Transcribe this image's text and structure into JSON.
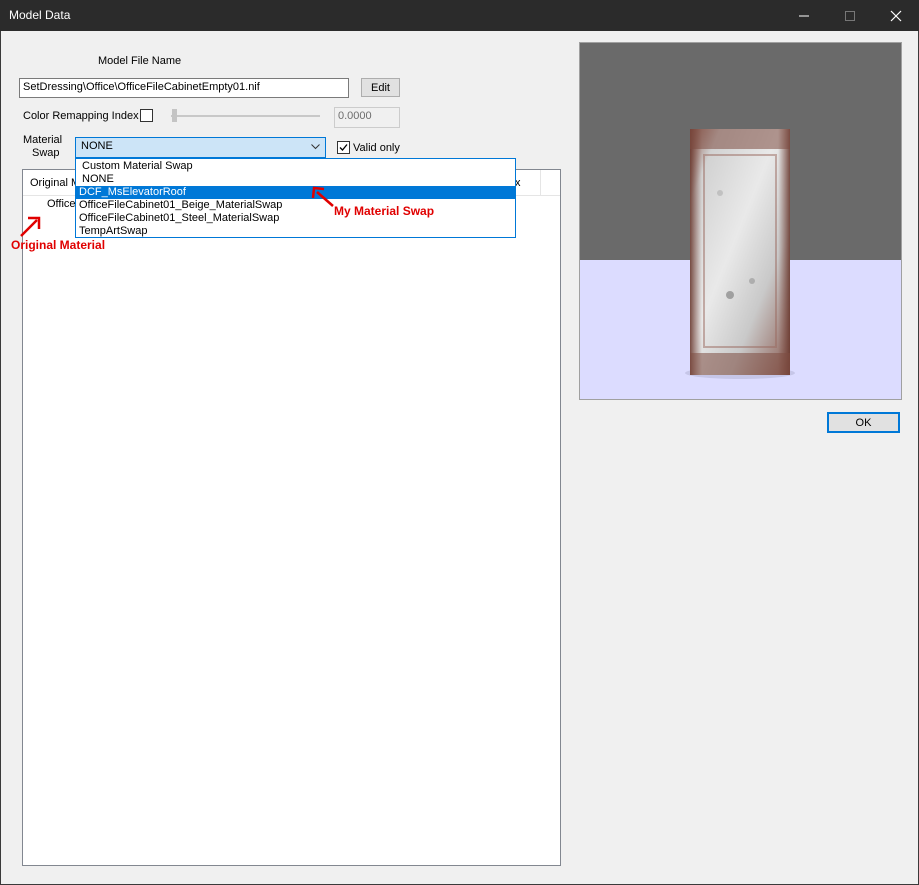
{
  "window": {
    "title": "Model Data",
    "minimize_icon": "minimize-icon",
    "maximize_icon": "maximize-icon",
    "close_icon": "close-icon"
  },
  "model_file": {
    "label": "Model File Name",
    "value": "SetDressing\\Office\\OfficeFileCabinetEmpty01.nif",
    "edit_label": "Edit"
  },
  "color_remap": {
    "label": "Color Remapping Index",
    "checked": false,
    "value": "0.0000",
    "slider_level": 0
  },
  "material_swap": {
    "label_line1": "Material",
    "label_line2": "Swap",
    "selected": "NONE",
    "valid_only_label": "Valid only",
    "valid_only_checked": true,
    "options": [
      "Custom Material Swap",
      "NONE",
      "DCF_MsElevatorRoof",
      "OfficeFileCabinet01_Beige_MaterialSwap",
      "OfficeFileCabinet01_Steel_MaterialSwap",
      "TempArtSwap"
    ],
    "highlighted_index": 2
  },
  "list": {
    "header_left": "Original M",
    "header_right": "x",
    "row_partial": "Office"
  },
  "annotations": {
    "my_swap": "My Material Swap",
    "original": "Original Material",
    "color": "#e00000"
  },
  "ok_label": "OK",
  "colors": {
    "accent": "#0078d7",
    "titlebar": "#2b2b2b",
    "dialog_bg": "#f0f0f0"
  }
}
